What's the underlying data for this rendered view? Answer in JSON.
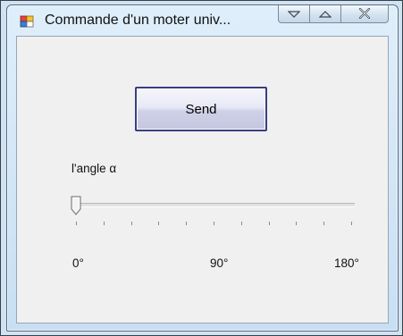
{
  "window": {
    "title": "Commande d'un moter univ...",
    "icon": "app-icon",
    "controls": [
      "minimize-icon",
      "maximize-icon",
      "close-icon"
    ]
  },
  "send_button": {
    "label": "Send"
  },
  "angle_slider": {
    "label": "l'angle α",
    "min": 0,
    "max": 180,
    "value": 0,
    "tick_count": 11,
    "tick_labels": [
      "0°",
      "90°",
      "180°"
    ]
  },
  "colors": {
    "title_bar": "#cfe3f5",
    "client_bg": "#f0f0f0",
    "button_border": "#3a3d80"
  }
}
